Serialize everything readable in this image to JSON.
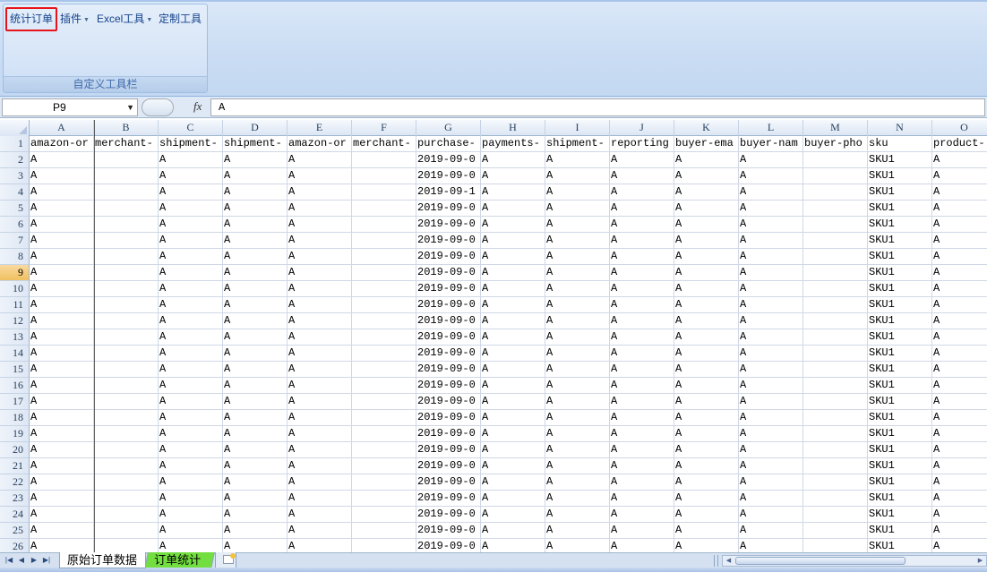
{
  "ribbon": {
    "buttons": [
      "统计订单",
      "插件",
      "Excel工具",
      "定制工具"
    ],
    "group_caption": "自定义工具栏"
  },
  "formula_bar": {
    "name_box": "P9",
    "fx": "fx",
    "formula": "A"
  },
  "grid": {
    "columns": [
      "A",
      "B",
      "C",
      "D",
      "E",
      "F",
      "G",
      "H",
      "I",
      "J",
      "K",
      "L",
      "M",
      "N",
      "O"
    ],
    "header_row": [
      "amazon-or",
      "merchant-",
      "shipment-",
      "shipment-",
      "amazon-or",
      "merchant-",
      "purchase-",
      "payments-",
      "shipment-",
      "reporting",
      "buyer-ema",
      "buyer-nam",
      "buyer-pho",
      "sku",
      "product-"
    ],
    "data_rows": [
      [
        "A",
        "",
        "A",
        "A",
        "A",
        "",
        "2019-09-0",
        "A",
        "A",
        "A",
        "A",
        "A",
        "",
        "SKU1",
        "A"
      ],
      [
        "A",
        "",
        "A",
        "A",
        "A",
        "",
        "2019-09-0",
        "A",
        "A",
        "A",
        "A",
        "A",
        "",
        "SKU1",
        "A"
      ],
      [
        "A",
        "",
        "A",
        "A",
        "A",
        "",
        "2019-09-1",
        "A",
        "A",
        "A",
        "A",
        "A",
        "",
        "SKU1",
        "A"
      ],
      [
        "A",
        "",
        "A",
        "A",
        "A",
        "",
        "2019-09-0",
        "A",
        "A",
        "A",
        "A",
        "A",
        "",
        "SKU1",
        "A"
      ],
      [
        "A",
        "",
        "A",
        "A",
        "A",
        "",
        "2019-09-0",
        "A",
        "A",
        "A",
        "A",
        "A",
        "",
        "SKU1",
        "A"
      ],
      [
        "A",
        "",
        "A",
        "A",
        "A",
        "",
        "2019-09-0",
        "A",
        "A",
        "A",
        "A",
        "A",
        "",
        "SKU1",
        "A"
      ],
      [
        "A",
        "",
        "A",
        "A",
        "A",
        "",
        "2019-09-0",
        "A",
        "A",
        "A",
        "A",
        "A",
        "",
        "SKU1",
        "A"
      ],
      [
        "A",
        "",
        "A",
        "A",
        "A",
        "",
        "2019-09-0",
        "A",
        "A",
        "A",
        "A",
        "A",
        "",
        "SKU1",
        "A"
      ],
      [
        "A",
        "",
        "A",
        "A",
        "A",
        "",
        "2019-09-0",
        "A",
        "A",
        "A",
        "A",
        "A",
        "",
        "SKU1",
        "A"
      ],
      [
        "A",
        "",
        "A",
        "A",
        "A",
        "",
        "2019-09-0",
        "A",
        "A",
        "A",
        "A",
        "A",
        "",
        "SKU1",
        "A"
      ],
      [
        "A",
        "",
        "A",
        "A",
        "A",
        "",
        "2019-09-0",
        "A",
        "A",
        "A",
        "A",
        "A",
        "",
        "SKU1",
        "A"
      ],
      [
        "A",
        "",
        "A",
        "A",
        "A",
        "",
        "2019-09-0",
        "A",
        "A",
        "A",
        "A",
        "A",
        "",
        "SKU1",
        "A"
      ],
      [
        "A",
        "",
        "A",
        "A",
        "A",
        "",
        "2019-09-0",
        "A",
        "A",
        "A",
        "A",
        "A",
        "",
        "SKU1",
        "A"
      ],
      [
        "A",
        "",
        "A",
        "A",
        "A",
        "",
        "2019-09-0",
        "A",
        "A",
        "A",
        "A",
        "A",
        "",
        "SKU1",
        "A"
      ],
      [
        "A",
        "",
        "A",
        "A",
        "A",
        "",
        "2019-09-0",
        "A",
        "A",
        "A",
        "A",
        "A",
        "",
        "SKU1",
        "A"
      ],
      [
        "A",
        "",
        "A",
        "A",
        "A",
        "",
        "2019-09-0",
        "A",
        "A",
        "A",
        "A",
        "A",
        "",
        "SKU1",
        "A"
      ],
      [
        "A",
        "",
        "A",
        "A",
        "A",
        "",
        "2019-09-0",
        "A",
        "A",
        "A",
        "A",
        "A",
        "",
        "SKU1",
        "A"
      ],
      [
        "A",
        "",
        "A",
        "A",
        "A",
        "",
        "2019-09-0",
        "A",
        "A",
        "A",
        "A",
        "A",
        "",
        "SKU1",
        "A"
      ],
      [
        "A",
        "",
        "A",
        "A",
        "A",
        "",
        "2019-09-0",
        "A",
        "A",
        "A",
        "A",
        "A",
        "",
        "SKU1",
        "A"
      ],
      [
        "A",
        "",
        "A",
        "A",
        "A",
        "",
        "2019-09-0",
        "A",
        "A",
        "A",
        "A",
        "A",
        "",
        "SKU1",
        "A"
      ],
      [
        "A",
        "",
        "A",
        "A",
        "A",
        "",
        "2019-09-0",
        "A",
        "A",
        "A",
        "A",
        "A",
        "",
        "SKU1",
        "A"
      ],
      [
        "A",
        "",
        "A",
        "A",
        "A",
        "",
        "2019-09-0",
        "A",
        "A",
        "A",
        "A",
        "A",
        "",
        "SKU1",
        "A"
      ],
      [
        "A",
        "",
        "A",
        "A",
        "A",
        "",
        "2019-09-0",
        "A",
        "A",
        "A",
        "A",
        "A",
        "",
        "SKU1",
        "A"
      ],
      [
        "A",
        "",
        "A",
        "A",
        "A",
        "",
        "2019-09-0",
        "A",
        "A",
        "A",
        "A",
        "A",
        "",
        "SKU1",
        "A"
      ],
      [
        "A",
        "",
        "A",
        "A",
        "A",
        "",
        "2019-09-0",
        "A",
        "A",
        "A",
        "A",
        "A",
        "",
        "SKU1",
        "A"
      ]
    ],
    "active_row": 9
  },
  "sheets": {
    "tabs": [
      "原始订单数据",
      "订单统计"
    ],
    "active_tab_color": "#ffffff",
    "second_tab_color": "#73de3f"
  },
  "colors": {
    "highlight_border": "#e8141b",
    "ribbon_text": "#15428b"
  }
}
